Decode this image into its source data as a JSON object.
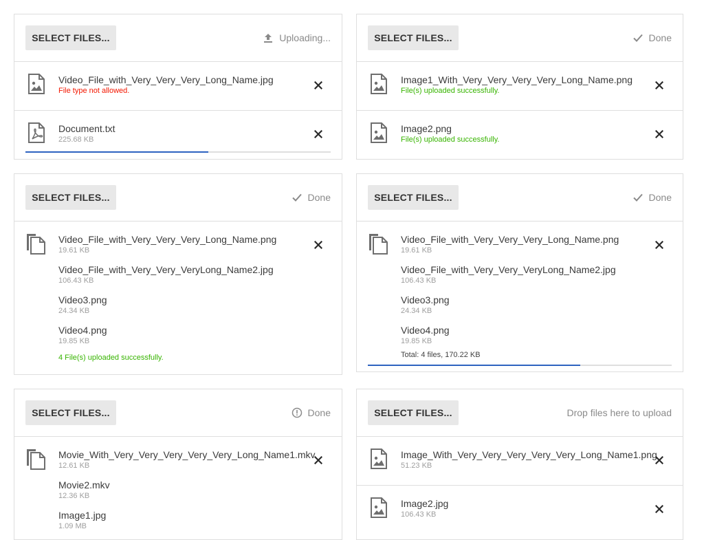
{
  "common": {
    "select_label": "SELECT FILES...",
    "done": "Done"
  },
  "colors": {
    "success": "#37b400",
    "error": "#f31700",
    "progress": "#2d62c0"
  },
  "panel1": {
    "status": "Uploading...",
    "status_icon": "upload-icon",
    "files": [
      {
        "name": "Video_File_with_Very_Very_Very_Long_Name.jpg",
        "message": "File type not allowed.",
        "icon": "image-file-icon"
      },
      {
        "name": "Document.txt",
        "size": "225.68 KB",
        "icon": "pdf-file-icon",
        "progress_fraction": 0.6
      }
    ]
  },
  "panel2": {
    "status_icon": "check-icon",
    "files": [
      {
        "name": "Image1_With_Very_Very_Very_Very_Long_Name.png",
        "message": "File(s) uploaded successfully.",
        "icon": "image-file-icon"
      },
      {
        "name": "Image2.png",
        "message": "File(s) uploaded successfully.",
        "icon": "image-file-icon"
      }
    ]
  },
  "panel3": {
    "status_icon": "check-icon",
    "group_icon": "multiple-files-icon",
    "files": [
      {
        "name": "Video_File_with_Very_Very_Very_Long_Name.png",
        "size": "19.61 KB"
      },
      {
        "name": "Video_File_with_Very_Very_VeryLong_Name2.jpg",
        "size": "106.43 KB"
      },
      {
        "name": "Video3.png",
        "size": "24.34 KB"
      },
      {
        "name": "Video4.png",
        "size": "19.85 KB"
      }
    ],
    "message": "4 File(s) uploaded successfully."
  },
  "panel4": {
    "status_icon": "check-icon",
    "group_icon": "multiple-files-icon",
    "files": [
      {
        "name": "Video_File_with_Very_Very_Very_Long_Name.png",
        "size": "19.61 KB"
      },
      {
        "name": "Video_File_with_Very_Very_VeryLong_Name2.jpg",
        "size": "106.43 KB"
      },
      {
        "name": "Video3.png",
        "size": "24.34 KB"
      },
      {
        "name": "Video4.png",
        "size": "19.85 KB"
      }
    ],
    "total": "Total: 4 files, 170.22 KB",
    "progress_fraction": 0.7
  },
  "panel5": {
    "status_icon": "warning-icon",
    "group_icon": "multiple-files-icon",
    "files": [
      {
        "name": "Movie_With_Very_Very_Very_Very_Very_Long_Name1.mkv",
        "size": "12.61 KB"
      },
      {
        "name": "Movie2.mkv",
        "size": "12.36 KB"
      },
      {
        "name": "Image1.jpg",
        "size": "1.09 MB"
      }
    ]
  },
  "panel6": {
    "status": "Drop files here to upload",
    "files": [
      {
        "name": "Image_With_Very_Very_Very_Very_Very_Long_Name1.png",
        "size": "51.23 KB",
        "icon": "image-file-icon"
      },
      {
        "name": "Image2.jpg",
        "size": "106.43 KB",
        "icon": "image-file-icon"
      }
    ]
  }
}
